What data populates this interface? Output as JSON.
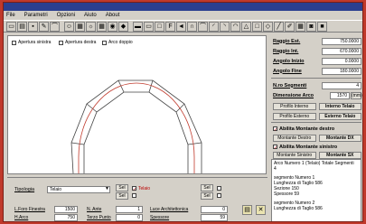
{
  "window": {
    "title": ""
  },
  "menu": [
    "File",
    "Parametri",
    "Opzioni",
    "Aiuto",
    "About"
  ],
  "canvas_options": {
    "apertura_sinistra": "Apertura sinistra",
    "apertura_destra": "Apertura destra",
    "arco_doppio": "Arco doppio"
  },
  "right_panel": {
    "raggio_est": {
      "label": "Raggio Est.",
      "value": "750.0000"
    },
    "raggio_int": {
      "label": "Raggio Int.",
      "value": "670.0000"
    },
    "angolo_inizio": {
      "label": "Angolo Inizio",
      "value": "0.0000"
    },
    "angolo_fine": {
      "label": "Angolo Fine",
      "value": "180.0000"
    },
    "n_segmenti": {
      "label": "N.ro Segmenti",
      "value": "4"
    },
    "dimensione_arco": {
      "label": "Dimensione Arco",
      "value": "1570",
      "unit": "(mm)"
    },
    "profilo_interno_btn": "Profilo Interno",
    "interno_telaio_btn": "Interno Telaio",
    "profilo_esterno_btn": "Profilo Esterno",
    "esterno_telaio_btn": "Esterno Telaio",
    "abilita_montante_destro": "Abilita Montante destro",
    "montante_destro_btn": "Montante Destro",
    "montante_dx_btn": "Montante DX",
    "abilita_montante_sinistro": "Abilita Montante sinistro",
    "montante_sinistro_btn": "Montante Sinistro",
    "montante_sx_btn": "Montante SX"
  },
  "info": {
    "header": "Arco Numero 1 (Telaio)  Totale Segmenti",
    "header_value": "4",
    "blocks": [
      {
        "title": "segmento Numero",
        "num": "1",
        "lines": [
          "Lunghezza di Taglio 586",
          "Sezione  150",
          "Spessore  59"
        ]
      },
      {
        "title": "segmento Numero",
        "num": "2",
        "lines": [
          "Lunghezza di Taglio 586"
        ]
      }
    ]
  },
  "bottom": {
    "tipologia_label": "Tipologia",
    "tipologia_value": "Telaio",
    "sel_label": "Sel",
    "telaio_label": "Telaio",
    "l_foro_label": "L.Foro Finestra",
    "l_foro_value": "1500",
    "h_arco_label": "H.Arco",
    "h_arco_value": "750",
    "n_ante_label": "N. Ante",
    "n_ante_value": "1",
    "terzo_punto_label": "Terzo Punto",
    "terzo_punto_value": "0",
    "luce_label": "Luce Architettonica",
    "luce_value": "0",
    "spessore_label": "Spessore",
    "spessore_value": "59"
  }
}
